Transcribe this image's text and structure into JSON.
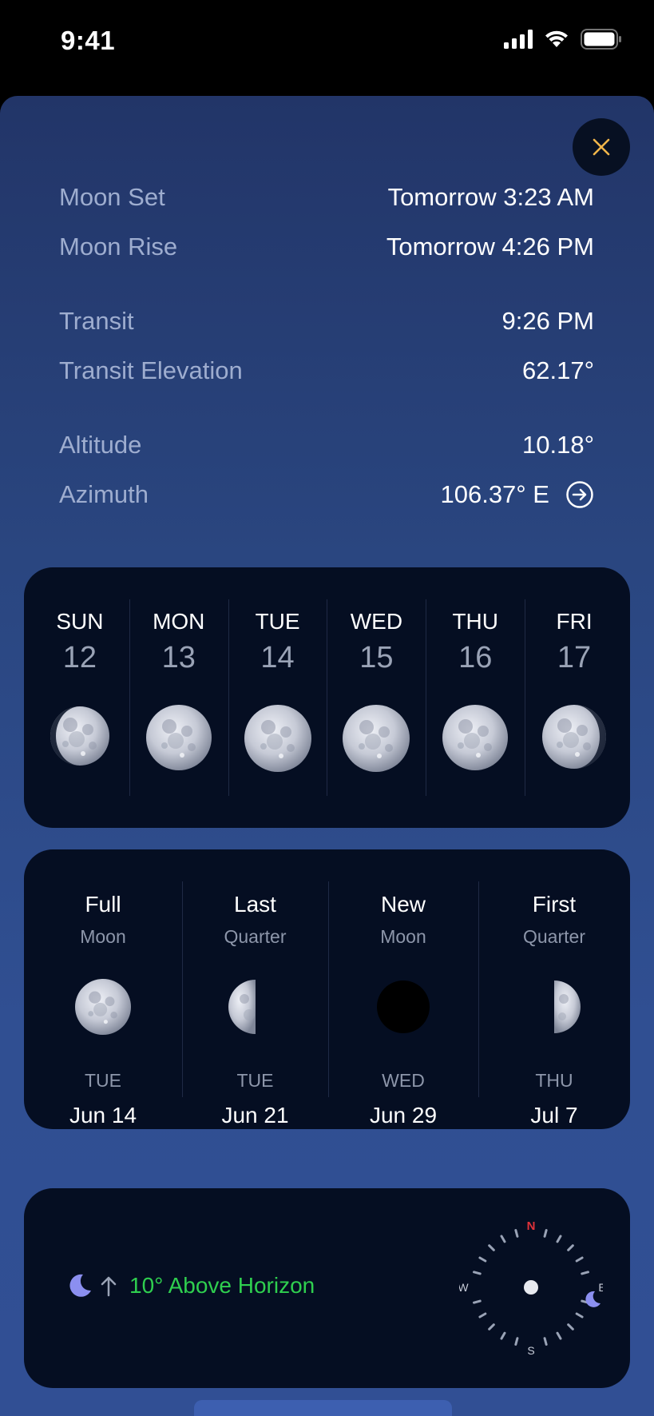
{
  "status_bar": {
    "time": "9:41"
  },
  "info_rows": [
    {
      "label": "Moon Set",
      "value": "Tomorrow 3:23 AM"
    },
    {
      "label": "Moon Rise",
      "value": "Tomorrow 4:26 PM"
    },
    {
      "label": "Transit",
      "value": "9:26 PM"
    },
    {
      "label": "Transit Elevation",
      "value": "62.17°"
    },
    {
      "label": "Altitude",
      "value": "10.18°"
    },
    {
      "label": "Azimuth",
      "value": "106.37° E"
    }
  ],
  "days": [
    {
      "name": "SUN",
      "num": "12"
    },
    {
      "name": "MON",
      "num": "13"
    },
    {
      "name": "TUE",
      "num": "14"
    },
    {
      "name": "WED",
      "num": "15"
    },
    {
      "name": "THU",
      "num": "16"
    },
    {
      "name": "FRI",
      "num": "17"
    }
  ],
  "phases": [
    {
      "name": "Full",
      "sub": "Moon",
      "day": "TUE",
      "date": "Jun 14"
    },
    {
      "name": "Last",
      "sub": "Quarter",
      "day": "TUE",
      "date": "Jun 21"
    },
    {
      "name": "New",
      "sub": "Moon",
      "day": "WED",
      "date": "Jun 29"
    },
    {
      "name": "First",
      "sub": "Quarter",
      "day": "THU",
      "date": "Jul 7"
    }
  ],
  "horizon": {
    "text": "10°  Above Horizon"
  },
  "compass": {
    "north": "N",
    "east": "E",
    "south": "S",
    "west": "W"
  },
  "colors": {
    "accent_close": "#f0b54a",
    "horizon_green": "#2fcf4f",
    "moon_icon": "#8b8ff0",
    "north_red": "#e0323a"
  }
}
